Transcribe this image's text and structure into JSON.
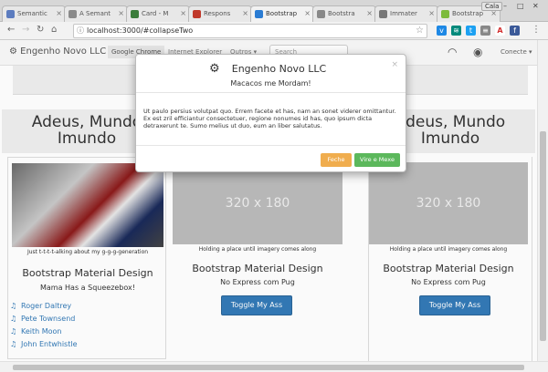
{
  "browser": {
    "tabs": [
      {
        "label": "Semantic",
        "color": "#5c7cbf"
      },
      {
        "label": "A Semant",
        "color": "#8a8a8a"
      },
      {
        "label": "Card - M",
        "color": "#3b7d3b"
      },
      {
        "label": "Respons",
        "color": "#c0392b"
      },
      {
        "label": "Bootstrap",
        "color": "#2b7cd3"
      },
      {
        "label": "Bootstra",
        "color": "#888888"
      },
      {
        "label": "Immater",
        "color": "#777777"
      },
      {
        "label": "Bootstrap",
        "color": "#7dbb3c"
      }
    ],
    "user_label": "Cala",
    "url": "localhost:3000/#collapseTwo"
  },
  "navbar": {
    "brand": "Engenho Novo LLC",
    "links": [
      "Google Chrome",
      "Internet Explorer",
      "Outros"
    ],
    "search_placeholder": "Search",
    "connect": "Conecte"
  },
  "columns": [
    {
      "heading": "Adeus, Mundo Imundo"
    },
    {
      "heading": ""
    },
    {
      "heading": "Adeus, Mundo Imundo"
    }
  ],
  "cards": [
    {
      "caption": "Just t-t-t-t-alking about my g-g-g-generation",
      "title": "Bootstrap Material Design",
      "subtitle": "Mama Has a Squeezebox!",
      "people": [
        "Roger Daltrey",
        "Pete Townsend",
        "Keith Moon",
        "John Entwhistle"
      ]
    },
    {
      "placeholder": "320 x 180",
      "caption": "Holding a place until imagery comes along",
      "title": "Bootstrap Material Design",
      "subtitle": "No Express com Pug",
      "button": "Toggle My Ass"
    },
    {
      "placeholder": "320 x 180",
      "caption": "Holding a place until imagery comes along",
      "title": "Bootstrap Material Design",
      "subtitle": "No Express com Pug",
      "button": "Toggle My Ass"
    }
  ],
  "modal": {
    "title": "Engenho Novo LLC",
    "subtitle": "Macacos me Mordam!",
    "body": "Ut paulo persius volutpat quo. Errem facete et has, nam an sonet viderer omittantur. Ex est zril efficiantur consectetuer, regione nonumes id has, quo ipsum dicta detraxerunt te. Sumo melius ut duo, eum an liber salutatus.",
    "close": "×",
    "btn_cancel": "Feche",
    "btn_ok": "Vire e Mexe",
    "btn_cancel_color": "#f0ad4e",
    "btn_ok_color": "#5cb85c"
  },
  "colors": {
    "primary": "#337ab7"
  }
}
